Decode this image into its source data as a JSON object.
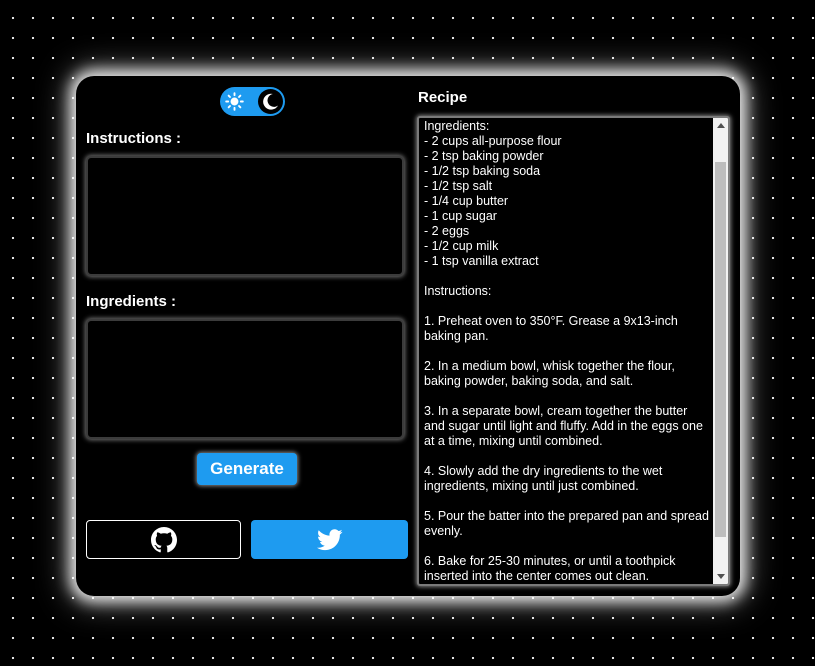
{
  "theme_toggle": {
    "light_icon": "sun-icon",
    "dark_icon": "moon-icon",
    "state": "dark",
    "accent": "#1e9bf0"
  },
  "form": {
    "instructions_label": "Instructions :",
    "instructions_value": "",
    "ingredients_label": "Ingredients :",
    "ingredients_value": "",
    "generate_label": "Generate"
  },
  "social": {
    "github_icon": "github-icon",
    "twitter_icon": "twitter-icon"
  },
  "recipe": {
    "title": "Recipe",
    "text": "Ingredients:\n- 2 cups all-purpose flour\n- 2 tsp baking powder\n- 1/2 tsp baking soda\n- 1/2 tsp salt\n- 1/4 cup butter\n- 1 cup sugar\n- 2 eggs\n- 1/2 cup milk\n- 1 tsp vanilla extract\n\nInstructions:\n\n1. Preheat oven to 350°F. Grease a 9x13-inch baking pan.\n\n2. In a medium bowl, whisk together the flour, baking powder, baking soda, and salt.\n\n3. In a separate bowl, cream together the butter and sugar until light and fluffy. Add in the eggs one at a time, mixing until combined.\n\n4. Slowly add the dry ingredients to the wet ingredients, mixing until just combined.\n\n5. Pour the batter into the prepared pan and spread evenly.\n\n6. Bake for 25-30 minutes, or until a toothpick inserted into the center comes out clean."
  },
  "colors": {
    "accent": "#1e9bf0",
    "background": "#000000",
    "text": "#ffffff"
  }
}
